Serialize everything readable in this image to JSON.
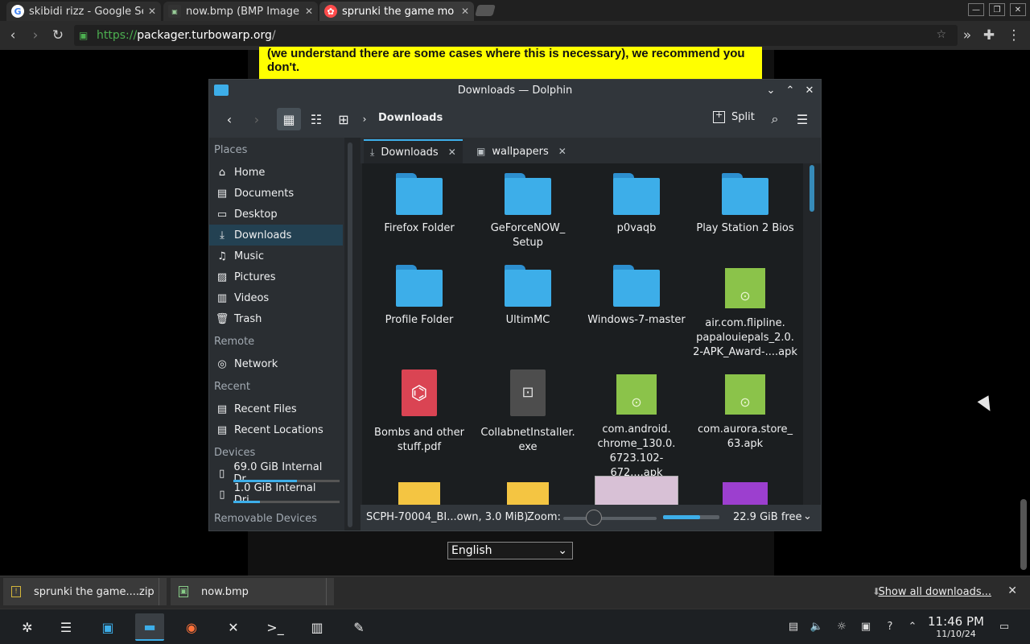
{
  "browser": {
    "tabs": [
      {
        "title": "skibidi rizz - Google Se",
        "favicon": "G",
        "active": false
      },
      {
        "title": "now.bmp (BMP Image",
        "favicon": "bmp",
        "active": false
      },
      {
        "title": "sprunki the game mo",
        "favicon": "turbowarp",
        "active": true
      }
    ],
    "url": {
      "scheme": "https://",
      "host": "packager.turbowarp.org",
      "path": "/"
    },
    "icons": [
      "back-icon",
      "forward-icon",
      "reload-icon",
      "lock-icon",
      "star-icon",
      "extensions-icon",
      "menu-icon"
    ]
  },
  "page": {
    "notice": "(we understand there are some cases where this is necessary), we recommend you don't.",
    "language": "English"
  },
  "dolphin": {
    "title": "Downloads — Dolphin",
    "breadcrumb": "Downloads",
    "split_label": "Split",
    "places": {
      "places_header": "Places",
      "places_items": [
        "Home",
        "Documents",
        "Desktop",
        "Downloads",
        "Music",
        "Pictures",
        "Videos",
        "Trash"
      ],
      "remote_header": "Remote",
      "remote_items": [
        "Network"
      ],
      "recent_header": "Recent",
      "recent_items": [
        "Recent Files",
        "Recent Locations"
      ],
      "devices_header": "Devices",
      "devices": [
        {
          "label": "69.0 GiB Internal Dr...",
          "used": 0.6
        },
        {
          "label": "1.0 GiB Internal Dri...",
          "used": 0.25
        }
      ],
      "removable_header": "Removable Devices"
    },
    "tabs": [
      {
        "label": "Downloads",
        "active": true
      },
      {
        "label": "wallpapers",
        "active": false
      }
    ],
    "files": [
      {
        "name": "Firefox Folder",
        "type": "folder"
      },
      {
        "name": "GeForceNOW_ Setup",
        "type": "folder"
      },
      {
        "name": "p0vaqb",
        "type": "folder"
      },
      {
        "name": "Play Station 2 Bios",
        "type": "folder"
      },
      {
        "name": "Profile Folder",
        "type": "folder"
      },
      {
        "name": "UltimMC",
        "type": "folder"
      },
      {
        "name": "Windows-7-master",
        "type": "folder"
      },
      {
        "name": "air.com.flipline. papalouiepals_2.0. 2-APK_Award-....apk",
        "type": "apk"
      },
      {
        "name": "Bombs and other stuff.pdf",
        "type": "pdf"
      },
      {
        "name": "CollabnetInstaller. exe",
        "type": "exe"
      },
      {
        "name": "com.android. chrome_130.0. 6723.102-672....apk",
        "type": "apk"
      },
      {
        "name": "com.aurora.store_ 63.apk",
        "type": "apk"
      }
    ],
    "status": {
      "selection": "SCPH-70004_BI...own, 3.0 MiB)",
      "zoom_label": "Zoom:",
      "free_space": "22.9 GiB free",
      "free_fraction": 0.66
    }
  },
  "downloads": {
    "items": [
      "sprunki the game....zip",
      "now.bmp"
    ],
    "show_all": "Show all downloads..."
  },
  "taskbar": {
    "time": "11:46 PM",
    "date": "11/10/24"
  },
  "colors": {
    "accent": "#3daee9",
    "notice_bg": "#ffff00",
    "apk_green": "#8bc34a",
    "pdf_red": "#da4453"
  }
}
